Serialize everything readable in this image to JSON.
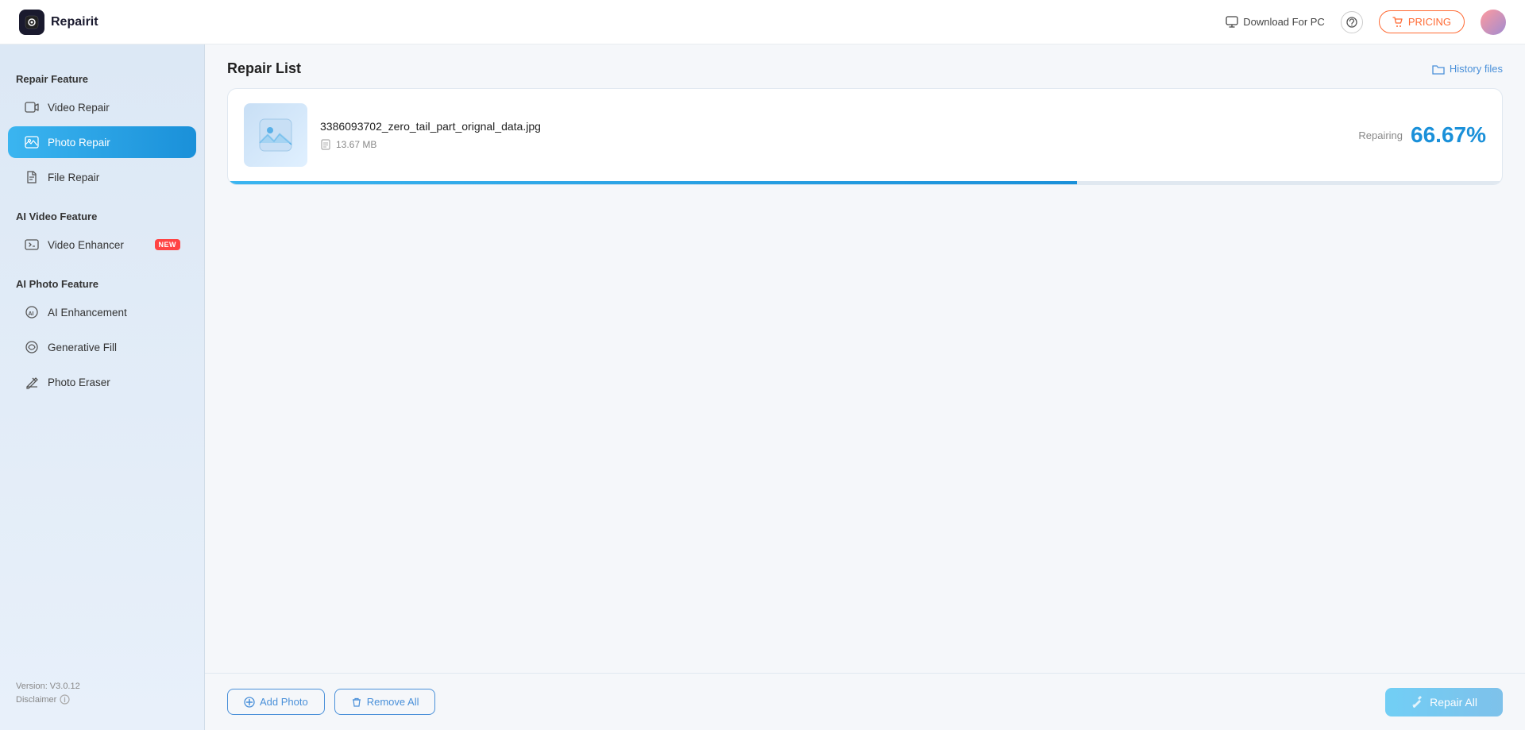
{
  "app": {
    "logo_text": "Repairit",
    "version": "Version: V3.0.12",
    "disclaimer": "Disclaimer"
  },
  "header": {
    "download_label": "Download For PC",
    "help_icon": "help-icon",
    "pricing_label": "PRICING",
    "pricing_icon": "cart-icon"
  },
  "sidebar": {
    "repair_feature_label": "Repair Feature",
    "ai_video_feature_label": "AI Video Feature",
    "ai_photo_feature_label": "AI Photo Feature",
    "items": [
      {
        "id": "video-repair",
        "label": "Video Repair",
        "active": false
      },
      {
        "id": "photo-repair",
        "label": "Photo Repair",
        "active": true
      },
      {
        "id": "file-repair",
        "label": "File Repair",
        "active": false
      },
      {
        "id": "video-enhancer",
        "label": "Video Enhancer",
        "active": false,
        "badge": "NEW"
      },
      {
        "id": "ai-enhancement",
        "label": "AI Enhancement",
        "active": false
      },
      {
        "id": "generative-fill",
        "label": "Generative Fill",
        "active": false
      },
      {
        "id": "photo-eraser",
        "label": "Photo Eraser",
        "active": false
      }
    ]
  },
  "content": {
    "page_title": "Repair List",
    "history_files_label": "History files"
  },
  "repair_item": {
    "filename": "3386093702_zero_tail_part_orignal_data.jpg",
    "filesize": "13.67 MB",
    "status_label": "Repairing",
    "percent": "66.67%",
    "progress": 66.67
  },
  "toolbar": {
    "add_photo_label": "Add Photo",
    "remove_all_label": "Remove All",
    "repair_all_label": "Repair All"
  },
  "colors": {
    "accent": "#1a90d9",
    "accent_light": "#3bb5f0",
    "active_bg_start": "#3bb5f0",
    "active_bg_end": "#1a90d9",
    "pricing_color": "#ff6b35"
  }
}
